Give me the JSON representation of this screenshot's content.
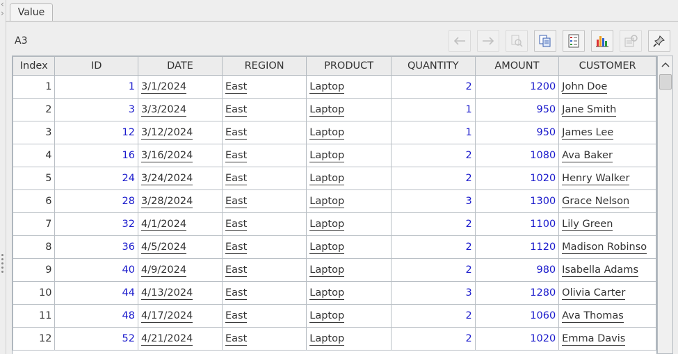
{
  "tab": {
    "label": "Value"
  },
  "cell_ref": "A3",
  "toolbar": {
    "buttons": [
      {
        "name": "back-arrow-icon",
        "enabled": false
      },
      {
        "name": "forward-arrow-icon",
        "enabled": false
      },
      {
        "name": "magnifier-icon",
        "enabled": false
      },
      {
        "name": "copy-icon",
        "enabled": true
      },
      {
        "name": "list-icon",
        "enabled": true
      },
      {
        "name": "bar-chart-icon",
        "enabled": true
      },
      {
        "name": "properties-icon",
        "enabled": false
      },
      {
        "name": "pin-icon",
        "enabled": true
      }
    ]
  },
  "table": {
    "columns": [
      "Index",
      "ID",
      "DATE",
      "REGION",
      "PRODUCT",
      "QUANTITY",
      "AMOUNT",
      "CUSTOMER"
    ],
    "rows": [
      [
        "1",
        "1",
        "3/1/2024",
        "East",
        "Laptop",
        "2",
        "1200",
        "John Doe"
      ],
      [
        "2",
        "3",
        "3/3/2024",
        "East",
        "Laptop",
        "1",
        "950",
        "Jane Smith"
      ],
      [
        "3",
        "12",
        "3/12/2024",
        "East",
        "Laptop",
        "1",
        "950",
        "James Lee"
      ],
      [
        "4",
        "16",
        "3/16/2024",
        "East",
        "Laptop",
        "2",
        "1080",
        "Ava Baker"
      ],
      [
        "5",
        "24",
        "3/24/2024",
        "East",
        "Laptop",
        "2",
        "1020",
        "Henry Walker"
      ],
      [
        "6",
        "28",
        "3/28/2024",
        "East",
        "Laptop",
        "3",
        "1300",
        "Grace Nelson"
      ],
      [
        "7",
        "32",
        "4/1/2024",
        "East",
        "Laptop",
        "2",
        "1100",
        "Lily Green"
      ],
      [
        "8",
        "36",
        "4/5/2024",
        "East",
        "Laptop",
        "2",
        "1120",
        "Madison Robinso"
      ],
      [
        "9",
        "40",
        "4/9/2024",
        "East",
        "Laptop",
        "2",
        "980",
        "Isabella Adams"
      ],
      [
        "10",
        "44",
        "4/13/2024",
        "East",
        "Laptop",
        "3",
        "1280",
        "Olivia Carter"
      ],
      [
        "11",
        "48",
        "4/17/2024",
        "East",
        "Laptop",
        "2",
        "1060",
        "Ava Thomas"
      ],
      [
        "12",
        "52",
        "4/21/2024",
        "East",
        "Laptop",
        "2",
        "1020",
        "Emma Davis"
      ]
    ]
  },
  "colors": {
    "number_text": "#1a1acc",
    "grid_line": "#b9bfc5",
    "header_bg": "#ececec"
  }
}
